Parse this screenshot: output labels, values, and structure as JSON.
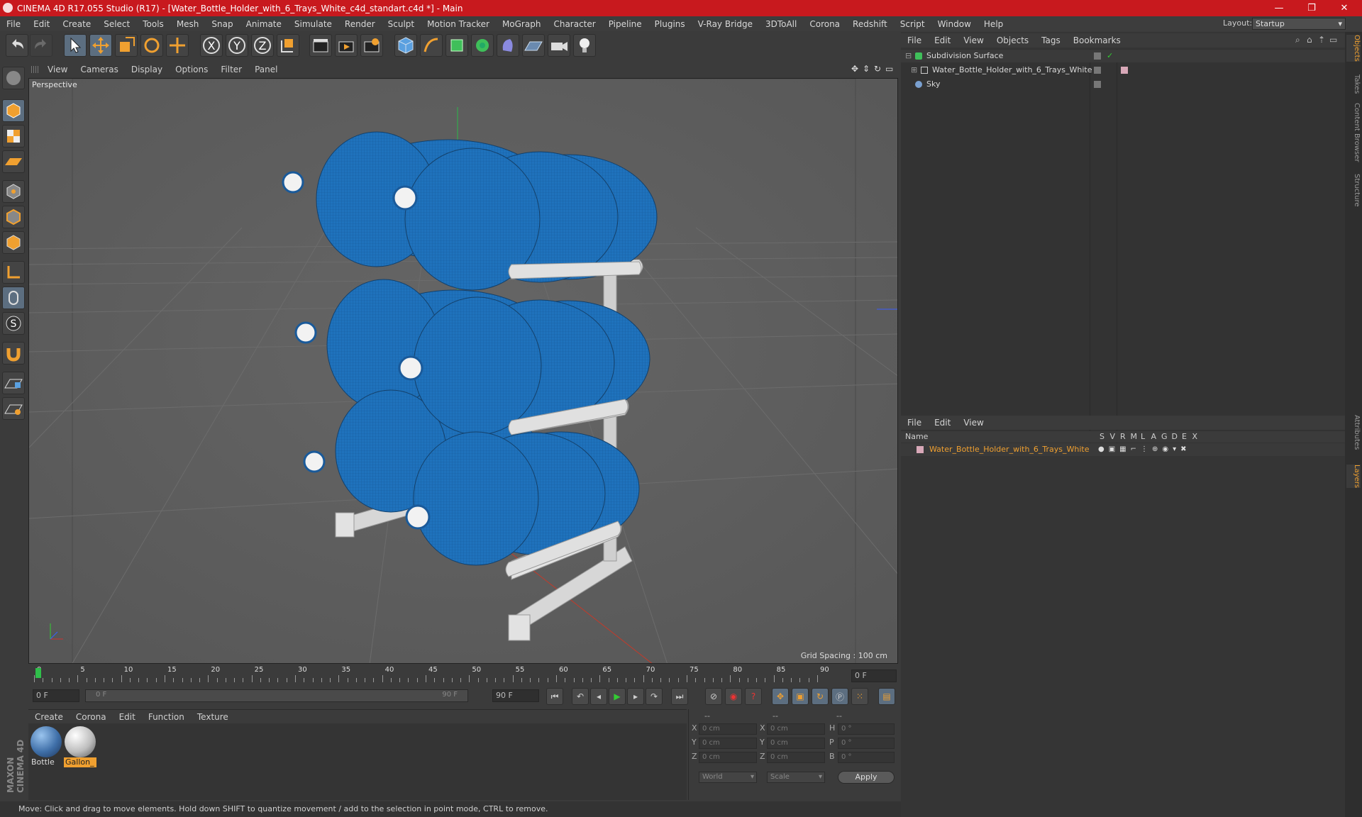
{
  "window": {
    "title": "CINEMA 4D R17.055 Studio (R17) - [Water_Bottle_Holder_with_6_Trays_White_c4d_standart.c4d *] - Main",
    "minimize": "—",
    "restore": "❐",
    "close": "✕"
  },
  "menu": [
    "File",
    "Edit",
    "Create",
    "Select",
    "Tools",
    "Mesh",
    "Snap",
    "Animate",
    "Simulate",
    "Render",
    "Sculpt",
    "Motion Tracker",
    "MoGraph",
    "Character",
    "Pipeline",
    "Plugins",
    "V-Ray Bridge",
    "3DToAll",
    "Corona",
    "Redshift",
    "Script",
    "Window",
    "Help"
  ],
  "layout": {
    "label": "Layout:",
    "value": "Startup"
  },
  "viewport": {
    "menu": [
      "View",
      "Cameras",
      "Display",
      "Options",
      "Filter",
      "Panel"
    ],
    "label": "Perspective",
    "grid_spacing": "Grid Spacing : 100 cm"
  },
  "timeline": {
    "ticks": [
      "0",
      "5",
      "10",
      "15",
      "20",
      "25",
      "30",
      "35",
      "40",
      "45",
      "50",
      "55",
      "60",
      "65",
      "70",
      "75",
      "80",
      "85",
      "90"
    ],
    "current_frame": "0 F",
    "start_field": "0 F",
    "range_start": "0 F",
    "range_end": "90 F",
    "end_field": "90 F"
  },
  "material_panel": {
    "menu": [
      "Create",
      "Corona",
      "Edit",
      "Function",
      "Texture"
    ],
    "materials": [
      {
        "name": "Bottle",
        "color": "#3f6fa8"
      },
      {
        "name": "Gallon_",
        "color": "#bdbdbd"
      }
    ]
  },
  "coords": {
    "header": [
      "--",
      "--",
      "--"
    ],
    "rows": [
      {
        "a": "X",
        "av": "0 cm",
        "b": "X",
        "bv": "0 cm",
        "c": "H",
        "cv": "0 °"
      },
      {
        "a": "Y",
        "av": "0 cm",
        "b": "Y",
        "bv": "0 cm",
        "c": "P",
        "cv": "0 °"
      },
      {
        "a": "Z",
        "av": "0 cm",
        "b": "Z",
        "bv": "0 cm",
        "c": "B",
        "cv": "0 °"
      }
    ],
    "mode1": "World",
    "mode2": "Scale",
    "apply": "Apply"
  },
  "objects": {
    "menu": [
      "File",
      "Edit",
      "View",
      "Objects",
      "Tags",
      "Bookmarks"
    ],
    "items": [
      {
        "name": "Subdivision Surface"
      },
      {
        "name": "Water_Bottle_Holder_with_6_Trays_White"
      },
      {
        "name": "Sky"
      }
    ]
  },
  "layers": {
    "menu": [
      "File",
      "Edit",
      "View"
    ],
    "header": {
      "name": "Name",
      "flags": [
        "S",
        "V",
        "R",
        "M",
        "L",
        "A",
        "G",
        "D",
        "E",
        "X"
      ]
    },
    "row": "Water_Bottle_Holder_with_6_Trays_White"
  },
  "side_tabs": [
    "Objects",
    "Takes",
    "Content Browser",
    "Structure",
    "Attributes",
    "Layers"
  ],
  "status": "Move: Click and drag to move elements. Hold down SHIFT to quantize movement / add to the selection in point mode, CTRL to remove.",
  "brand": "MAXON CINEMA 4D",
  "colors": {
    "accent": "#c8191e",
    "bottle": "#1e6fb8",
    "selected": "#f0a030"
  }
}
